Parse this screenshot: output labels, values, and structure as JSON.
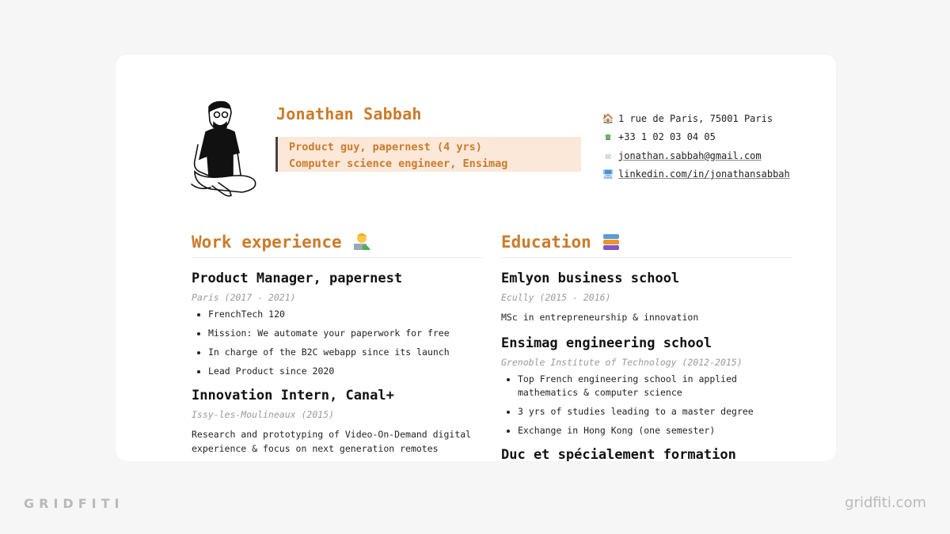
{
  "profile": {
    "name": "Jonathan Sabbah",
    "tagline": [
      "Product guy, papernest (4 yrs)",
      "Computer science engineer, Ensimag"
    ],
    "avatar_icon": "sitting-person-illustration"
  },
  "contacts": [
    {
      "icon": "house-icon",
      "glyph": "🏠",
      "text": "1 rue de Paris, 75001 Paris",
      "link": false
    },
    {
      "icon": "phone-icon",
      "glyph": "☎",
      "text": "+33 1 02 03 04 05",
      "link": false
    },
    {
      "icon": "envelope-icon",
      "glyph": "✉",
      "text": "jonathan.sabbah@gmail.com",
      "link": true
    },
    {
      "icon": "computer-icon",
      "glyph": "🖥",
      "text": "linkedin.com/in/jonathansabbah",
      "link": true
    }
  ],
  "work": {
    "title": "Work experience",
    "emoji": "technologist-icon",
    "entries": [
      {
        "title": "Product Manager, papernest",
        "sub": "Paris (2017 - 2021)",
        "bullets": [
          "FrenchTech 120",
          "Mission: We automate your paperwork for free",
          "In charge of the B2C webapp since its launch",
          "Lead Product since 2020"
        ]
      },
      {
        "title": "Innovation Intern, Canal+",
        "sub": "Issy-les-Moulineaux (2015)",
        "text": "Research and prototyping of Video-On-Demand digital experience & focus on next generation remotes"
      }
    ]
  },
  "education": {
    "title": "Education",
    "emoji": "books-icon",
    "entries": [
      {
        "title": "Emlyon business school",
        "sub": "Ecully (2015 - 2016)",
        "text": "MSc in entrepreneurship & innovation"
      },
      {
        "title": "Ensimag engineering school",
        "sub": "Grenoble Institute of Technology (2012-2015)",
        "bullets": [
          "Top French engineering school in applied mathematics & computer science",
          "3 yrs of studies leading to a master degree",
          "Exchange in Hong Kong (one semester)"
        ]
      },
      {
        "title": "Duc et spécialement formation"
      }
    ]
  },
  "footer": {
    "brand": "GRIDFITI",
    "site": "gridfiti.com"
  }
}
